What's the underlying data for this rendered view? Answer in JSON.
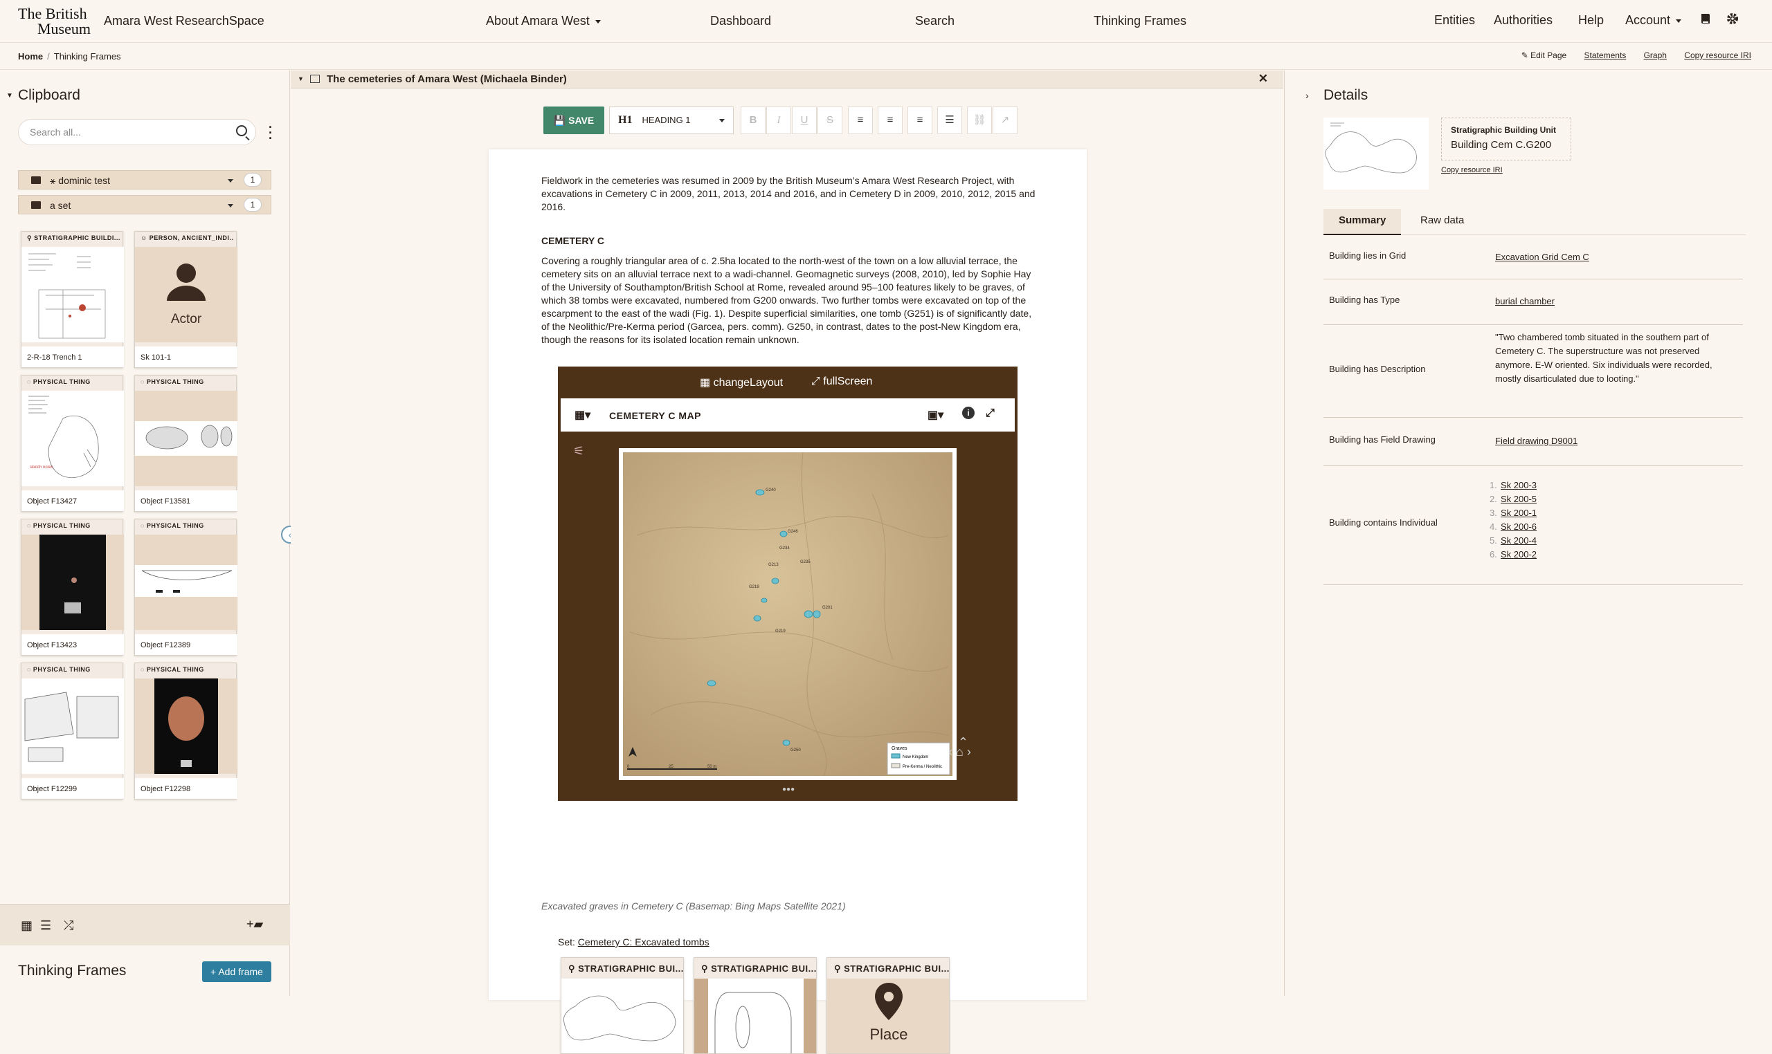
{
  "header": {
    "logo_line1": "The British",
    "logo_line2": "Museum",
    "app_title": "Amara West ResearchSpace",
    "nav": [
      "About Amara West",
      "Dashboard",
      "Search",
      "Thinking Frames"
    ],
    "right_nav": [
      "Entities",
      "Authorities",
      "Help",
      "Account"
    ]
  },
  "breadcrumb": {
    "home": "Home",
    "current": "Thinking Frames"
  },
  "page_actions": {
    "edit": "Edit Page",
    "statements": "Statements",
    "graph": "Graph",
    "copy_iri": "Copy resource IRI"
  },
  "clipboard": {
    "title": "Clipboard",
    "search_placeholder": "Search all...",
    "sets": [
      {
        "name": "dominic test",
        "count": "1"
      },
      {
        "name": "a set",
        "count": "1"
      }
    ],
    "cards": [
      {
        "type": "STRATIGRAPHIC BUILDI...",
        "label": "2-R-18 Trench 1"
      },
      {
        "type": "PERSON, ANCIENT_INDI...",
        "label": "Sk 101-1",
        "placeholder": "Actor"
      },
      {
        "type": "PHYSICAL THING",
        "label": "Object F13427"
      },
      {
        "type": "PHYSICAL THING",
        "label": "Object F13581"
      },
      {
        "type": "PHYSICAL THING",
        "label": "Object F13423"
      },
      {
        "type": "PHYSICAL THING",
        "label": "Object F12389"
      },
      {
        "type": "PHYSICAL THING",
        "label": "Object F12299"
      },
      {
        "type": "PHYSICAL THING",
        "label": "Object F12298"
      }
    ]
  },
  "thinking_frames": {
    "title": "Thinking Frames",
    "add_label": "Add frame"
  },
  "frame": {
    "title": "The cemeteries of Amara West (Michaela Binder)"
  },
  "editor": {
    "save": "SAVE",
    "heading": "HEADING 1",
    "heading_icon": "H1",
    "intro": "Fieldwork in the cemeteries was resumed in 2009 by the British Museum’s Amara West Research Project, with excavations in Cemetery C in 2009, 2011, 2013, 2014 and 2016, and in Cemetery D in 2009, 2010, 2012, 2015 and 2016.",
    "section_heading": "CEMETERY C",
    "section_text": "Covering a roughly triangular area of c. 2.5ha located to the north-west of the town on a low alluvial terrace, the cemetery sits on an alluvial terrace next to a wadi-channel. Geomagnetic surveys (2008, 2010), led by Sophie Hay of the University of Southampton/British School at Rome, revealed around 95–100 features likely to be graves, of which 38 tombs were excavated, numbered from G200 onwards. Two further tombs were excavated on top of the escarpment to the east of the wadi (Fig. 1). Despite superficial similarities, one tomb (G251) is of significantly date, of the Neolithic/Pre-Kerma period (Garcea, pers. comm). G250, in contrast, dates to the post-New Kingdom era, though the reasons for its isolated location remain unknown.",
    "caption": "Excavated graves in Cemetery C (Basemap: Bing Maps Satellite 2021)",
    "set_prefix": "Set:",
    "set_link": "Cemetery C: Excavated tombs",
    "set_cards": [
      {
        "type": "STRATIGRAPHIC BUI..."
      },
      {
        "type": "STRATIGRAPHIC BUI..."
      },
      {
        "type": "STRATIGRAPHIC BUI...",
        "placeholder": "Place"
      }
    ]
  },
  "map_widget": {
    "change_layout": "changeLayout",
    "full_screen": "fullScreen",
    "title": "CEMETERY C MAP",
    "legend_title": "Graves",
    "legend_items": [
      "New Kingdom",
      "Pre-Kerma / Neolithic"
    ],
    "scale_labels": [
      "0",
      "25",
      "50 m"
    ],
    "grave_labels": [
      "G240",
      "G246",
      "G234",
      "G213",
      "G235",
      "G218",
      "G201",
      "G219",
      "G250"
    ]
  },
  "details": {
    "title": "Details",
    "type_label": "Stratigraphic Building Unit",
    "name": "Building Cem C.G200",
    "copy_iri": "Copy resource IRI",
    "tabs": [
      "Summary",
      "Raw data"
    ],
    "rows": [
      {
        "key": "Building lies in Grid",
        "value": "Excavation Grid Cem C"
      },
      {
        "key": "Building has Type",
        "value": "burial chamber"
      },
      {
        "key": "Building has Description",
        "value": "\"Two chambered tomb situated in the southern part of Cemetery C. The superstructure was not preserved anymore. E-W oriented. Six individuals were recorded, mostly disarticulated due to looting.\""
      },
      {
        "key": "Building has Field Drawing",
        "value": "Field drawing D9001"
      },
      {
        "key": "Building contains Individual",
        "items": [
          "Sk 200-3",
          "Sk 200-5",
          "Sk 200-1",
          "Sk 200-6",
          "Sk 200-4",
          "Sk 200-2"
        ]
      }
    ]
  }
}
